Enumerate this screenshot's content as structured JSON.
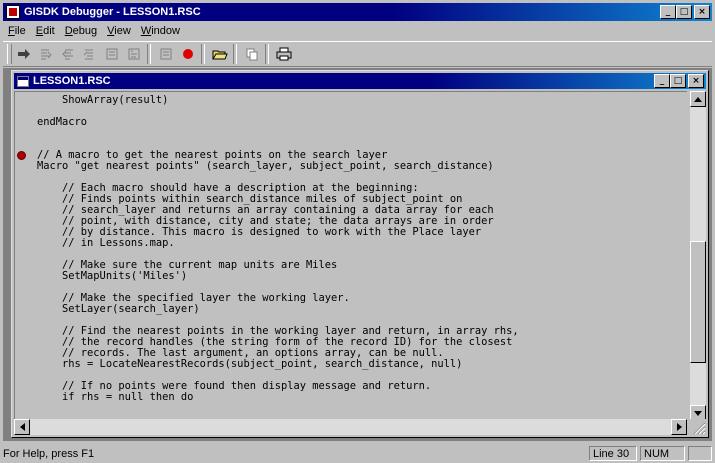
{
  "app": {
    "title": "GISDK Debugger - LESSON1.RSC",
    "window_buttons": {
      "minimize": "_",
      "maximize": "□",
      "close": "×"
    }
  },
  "menu": [
    {
      "label": "File",
      "underline": "F",
      "rest": "ile"
    },
    {
      "label": "Edit",
      "underline": "E",
      "rest": "dit"
    },
    {
      "label": "Debug",
      "underline": "D",
      "rest": "ebug"
    },
    {
      "label": "View",
      "underline": "V",
      "rest": "iew"
    },
    {
      "label": "Window",
      "underline": "W",
      "rest": "indow"
    }
  ],
  "toolbar": {
    "icons": [
      "run-arrow-icon",
      "step-over-icon",
      "step-into-icon",
      "step-out-icon",
      "watch-icon",
      "stack-icon",
      "breakpoint-toggle-icon",
      "open-folder-icon",
      "copy-icon",
      "print-icon"
    ]
  },
  "editor": {
    "title": "LESSON1.RSC",
    "breakpoint_line_index": 5,
    "lines": [
      "    ShowArray(result)",
      "",
      "endMacro",
      "",
      "",
      "// A macro to get the nearest points on the search layer",
      "Macro \"get nearest points\" (search_layer, subject_point, search_distance)",
      "",
      "    // Each macro should have a description at the beginning:",
      "    // Finds points within search_distance miles of subject_point on",
      "    // search_layer and returns an array containing a data array for each",
      "    // point, with distance, city and state; the data arrays are in order",
      "    // by distance. This macro is designed to work with the Place layer",
      "    // in Lessons.map.",
      "",
      "    // Make sure the current map units are Miles",
      "    SetMapUnits('Miles')",
      "",
      "    // Make the specified layer the working layer.",
      "    SetLayer(search_layer)",
      "",
      "    // Find the nearest points in the working layer and return, in array rhs,",
      "    // the record handles (the string form of the record ID) for the closest",
      "    // records. The last argument, an options array, can be null.",
      "    rhs = LocateNearestRecords(subject_point, search_distance, null)",
      "",
      "    // If no points were found then display message and return.",
      "    if rhs = null then do"
    ]
  },
  "status": {
    "help_text": "For Help, press F1",
    "line_indicator": "Line 30",
    "num_indicator": "NUM"
  }
}
